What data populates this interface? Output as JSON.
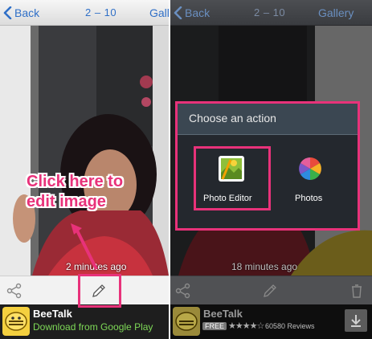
{
  "left_screen": {
    "header": {
      "back_label": "Back",
      "counter": "2 – 10",
      "gallery_label": "Gall"
    },
    "timestamp": "2 minutes ago",
    "toolbar": {
      "share_icon": "share-icon",
      "edit_icon": "pencil-icon"
    },
    "ad": {
      "title": "BeeTalk",
      "subtitle": "Download from Google Play"
    },
    "annotation": "Click here to edit image"
  },
  "right_screen": {
    "header": {
      "back_label": "Back",
      "counter": "2 – 10",
      "gallery_label": "Gallery"
    },
    "timestamp": "18 minutes ago",
    "toolbar": {
      "share_icon": "share-icon",
      "edit_icon": "pencil-icon",
      "delete_icon": "trash-icon"
    },
    "dialog": {
      "title": "Choose an action",
      "options": [
        {
          "label": "Photo Editor",
          "icon": "photo-editor-icon"
        },
        {
          "label": "Photos",
          "icon": "photos-pinwheel-icon"
        }
      ]
    },
    "ad": {
      "title": "BeeTalk",
      "badge": "FREE",
      "stars": "★★★★☆",
      "reviews": "60580 Reviews",
      "download_icon": "download-icon"
    }
  },
  "colors": {
    "accent": "#e8327a",
    "link_blue": "#2f6fc7",
    "ad_green": "#7ed957"
  }
}
